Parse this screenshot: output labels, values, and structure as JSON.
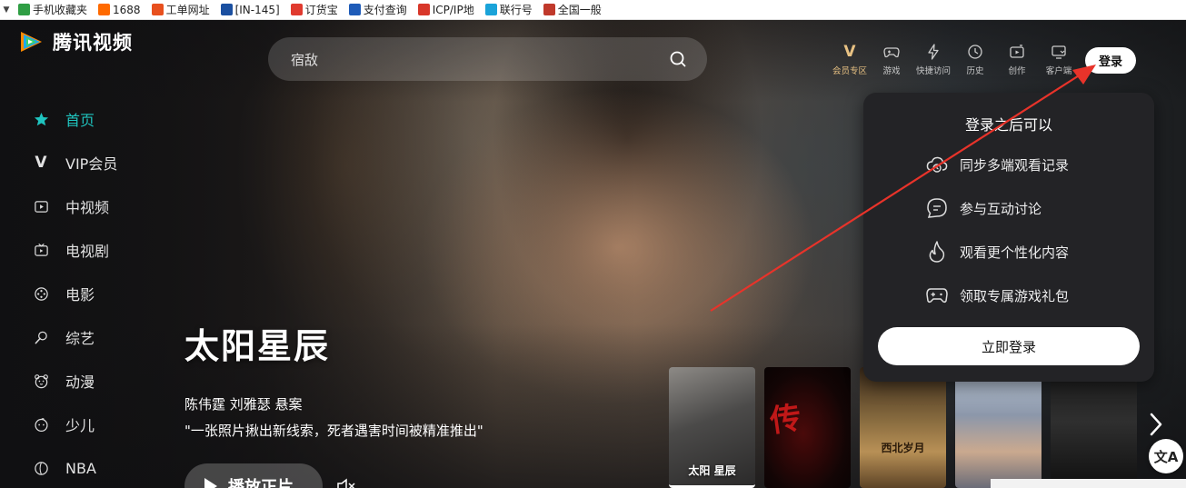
{
  "bookmarks": {
    "items": [
      {
        "label": "手机收藏夹",
        "icon": "phone-icon",
        "color": "#2f9e44"
      },
      {
        "label": "1688",
        "icon": "1688-logo-icon",
        "color": "#ff6a00"
      },
      {
        "label": "工单网址",
        "icon": "ticket-icon",
        "color": "#e8501e"
      },
      {
        "label": "[IN-145]",
        "icon": "jira-icon",
        "color": "#1a4fa0"
      },
      {
        "label": "订货宝",
        "icon": "order-icon",
        "color": "#e03a2f"
      },
      {
        "label": "支付查询",
        "icon": "qbi-logo-icon",
        "color": "#1e5bb8"
      },
      {
        "label": "ICP/IP地",
        "icon": "icp-icon",
        "color": "#d8372a"
      },
      {
        "label": "联行号",
        "icon": "bank-icon",
        "color": "#1aa3d9"
      },
      {
        "label": "全国一般",
        "icon": "building-icon",
        "color": "#c0392b"
      }
    ]
  },
  "header": {
    "logo_text": "腾讯视频",
    "search_placeholder": "宿敌",
    "nav": [
      {
        "label": "会员专区",
        "icon": "vip-icon"
      },
      {
        "label": "游戏",
        "icon": "gamepad-icon"
      },
      {
        "label": "快捷访问",
        "icon": "lightning-icon"
      },
      {
        "label": "历史",
        "icon": "clock-icon"
      },
      {
        "label": "创作",
        "icon": "camera-icon"
      },
      {
        "label": "客户端",
        "icon": "monitor-icon"
      }
    ],
    "vip_glyph": "V",
    "login_label": "登录"
  },
  "sidebar": {
    "items": [
      {
        "label": "首页",
        "icon": "star-icon",
        "active": true
      },
      {
        "label": "VIP会员",
        "icon": "vip-v-icon"
      },
      {
        "label": "中视频",
        "icon": "play-square-icon"
      },
      {
        "label": "电视剧",
        "icon": "tv-icon"
      },
      {
        "label": "电影",
        "icon": "film-reel-icon"
      },
      {
        "label": "综艺",
        "icon": "microphone-icon"
      },
      {
        "label": "动漫",
        "icon": "bear-icon"
      },
      {
        "label": "少儿",
        "icon": "kid-face-icon"
      },
      {
        "label": "NBA",
        "icon": "basketball-icon"
      }
    ],
    "vip_glyph": "V"
  },
  "hero": {
    "title": "太阳星辰",
    "meta": "陈伟霆 刘雅瑟 悬案",
    "quote": "\"一张照片揪出新线索，死者遇害时间被精准推出\"",
    "play_label": "播放正片"
  },
  "thumbnails": [
    {
      "caption": "太阳 星辰",
      "active": true
    },
    {
      "caption": "传"
    },
    {
      "caption": "西北岁月"
    },
    {
      "caption": ""
    },
    {
      "caption": ""
    }
  ],
  "login_popup": {
    "title": "登录之后可以",
    "benefits": [
      {
        "label": "同步多端观看记录",
        "icon": "cloud-sync-icon"
      },
      {
        "label": "参与互动讨论",
        "icon": "chat-bubble-icon"
      },
      {
        "label": "观看更个性化内容",
        "icon": "flame-icon"
      },
      {
        "label": "领取专属游戏礼包",
        "icon": "gamepad-icon"
      }
    ],
    "button_label": "立即登录"
  },
  "translate_glyph": "文A",
  "colors": {
    "accent": "#1fc4bf",
    "vip_gold": "#e9c283",
    "annotation_red": "#e8332a"
  }
}
